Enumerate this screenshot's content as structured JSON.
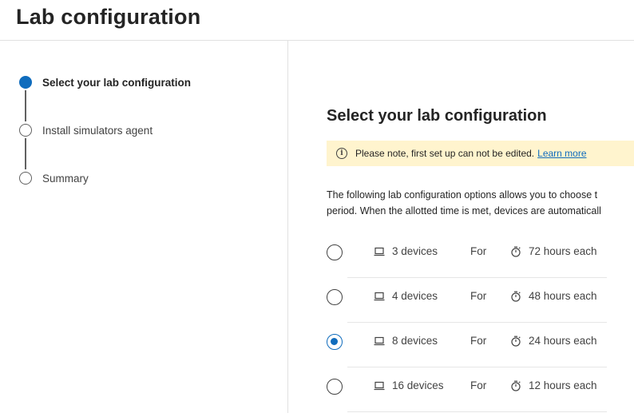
{
  "page": {
    "title": "Lab configuration"
  },
  "stepper": {
    "steps": [
      {
        "label": "Select your lab configuration",
        "state": "active"
      },
      {
        "label": "Install simulators agent",
        "state": "pending"
      },
      {
        "label": "Summary",
        "state": "pending"
      }
    ]
  },
  "main": {
    "title": "Select your lab configuration",
    "notice": {
      "icon": "info-icon",
      "text": "Please note, first set up can not be edited.",
      "link": "Learn more"
    },
    "description": [
      "The following lab configuration options allows you to choose t",
      "period. When the allotted time is met, devices are automaticall"
    ],
    "options": [
      {
        "devices": "3 devices",
        "for": "For",
        "duration": "72 hours each",
        "selected": false
      },
      {
        "devices": "4 devices",
        "for": "For",
        "duration": "48 hours each",
        "selected": false
      },
      {
        "devices": "8 devices",
        "for": "For",
        "duration": "24 hours each",
        "selected": true
      },
      {
        "devices": "16 devices",
        "for": "For",
        "duration": "12 hours each",
        "selected": false
      }
    ]
  },
  "colors": {
    "accent": "#0f6cbd",
    "notice_bg": "#fff4ce",
    "divider": "#e1e1e1"
  }
}
